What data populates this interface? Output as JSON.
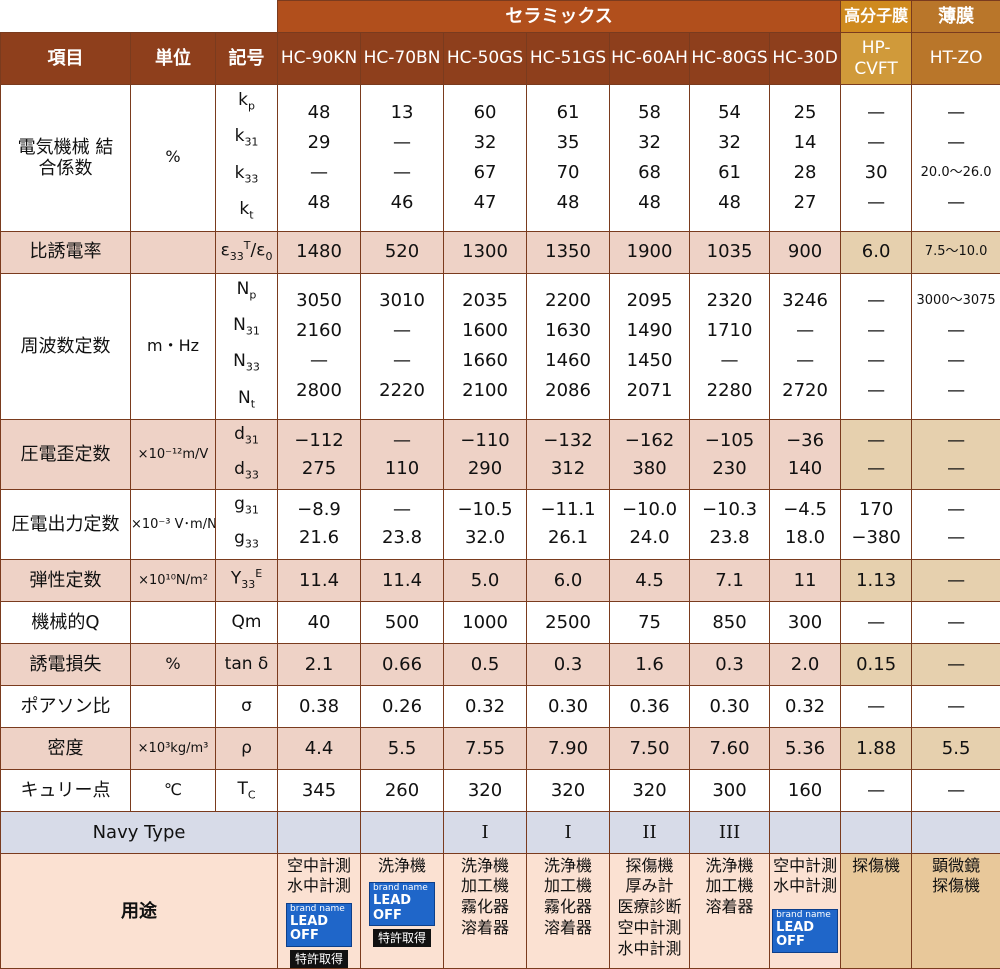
{
  "groups": {
    "ceramics": "セラミックス",
    "polymer": "高分子膜",
    "thin": "薄膜"
  },
  "header": {
    "item": "項目",
    "unit": "単位",
    "symbol": "記号",
    "models": [
      "HC-90KN",
      "HC-70BN",
      "HC-50GS",
      "HC-51GS",
      "HC-60AH",
      "HC-80GS",
      "HC-30D",
      "HP-CVFT",
      "HT-ZO"
    ]
  },
  "rows": [
    {
      "item": "電気機械 結合係数",
      "unit": "%",
      "cls": "",
      "symbols": [
        {
          "m": "k",
          "s": "p",
          "t": "sub"
        },
        {
          "m": "k",
          "s": "31",
          "t": "sub"
        },
        {
          "m": "k",
          "s": "33",
          "t": "sub"
        },
        {
          "m": "k",
          "s": "t",
          "t": "sub"
        }
      ],
      "values": [
        [
          "48",
          "29",
          "—",
          "48"
        ],
        [
          "13",
          "—",
          "—",
          "46"
        ],
        [
          "60",
          "32",
          "67",
          "47"
        ],
        [
          "61",
          "35",
          "70",
          "48"
        ],
        [
          "58",
          "32",
          "68",
          "48"
        ],
        [
          "54",
          "32",
          "61",
          "48"
        ],
        [
          "25",
          "14",
          "28",
          "27"
        ],
        [
          "—",
          "—",
          "30",
          "—"
        ],
        [
          "—",
          "—",
          "20.0～26.0",
          "—"
        ]
      ]
    },
    {
      "item": "比誘電率",
      "unit": "",
      "cls": "pink",
      "symbols": [
        {
          "m": "ε",
          "s": "33",
          "t": "sub",
          "sup": "T",
          "after": "/ε",
          "s2": "0"
        }
      ],
      "values": [
        [
          "1480"
        ],
        [
          "520"
        ],
        [
          "1300"
        ],
        [
          "1350"
        ],
        [
          "1900"
        ],
        [
          "1035"
        ],
        [
          "900"
        ],
        [
          "6.0"
        ],
        [
          "7.5～10.0"
        ]
      ]
    },
    {
      "item": "周波数定数",
      "unit": "m・Hz",
      "cls": "",
      "symbols": [
        {
          "m": "N",
          "s": "p",
          "t": "sub"
        },
        {
          "m": "N",
          "s": "31",
          "t": "sub"
        },
        {
          "m": "N",
          "s": "33",
          "t": "sub"
        },
        {
          "m": "N",
          "s": "t",
          "t": "sub"
        }
      ],
      "values": [
        [
          "3050",
          "2160",
          "—",
          "2800"
        ],
        [
          "3010",
          "—",
          "—",
          "2220"
        ],
        [
          "2035",
          "1600",
          "1660",
          "2100"
        ],
        [
          "2200",
          "1630",
          "1460",
          "2086"
        ],
        [
          "2095",
          "1490",
          "1450",
          "2071"
        ],
        [
          "2320",
          "1710",
          "—",
          "2280"
        ],
        [
          "3246",
          "—",
          "—",
          "2720"
        ],
        [
          "—",
          "—",
          "—",
          "—"
        ],
        [
          "3000～3075",
          "—",
          "—",
          "—"
        ]
      ]
    },
    {
      "item": "圧電歪定数",
      "unit": "×10⁻¹²m/V",
      "cls": "pink",
      "symbols": [
        {
          "m": "d",
          "s": "31",
          "t": "sub"
        },
        {
          "m": "d",
          "s": "33",
          "t": "sub"
        }
      ],
      "values": [
        [
          "−112",
          "275"
        ],
        [
          "—",
          "110"
        ],
        [
          "−110",
          "290"
        ],
        [
          "−132",
          "312"
        ],
        [
          "−162",
          "380"
        ],
        [
          "−105",
          "230"
        ],
        [
          "−36",
          "140"
        ],
        [
          "—",
          "—"
        ],
        [
          "—",
          "—"
        ]
      ]
    },
    {
      "item": "圧電出力定数",
      "unit": "×10⁻³ V･m/N",
      "cls": "",
      "symbols": [
        {
          "m": "g",
          "s": "31",
          "t": "sub"
        },
        {
          "m": "g",
          "s": "33",
          "t": "sub"
        }
      ],
      "values": [
        [
          "−8.9",
          "21.6"
        ],
        [
          "—",
          "23.8"
        ],
        [
          "−10.5",
          "32.0"
        ],
        [
          "−11.1",
          "26.1"
        ],
        [
          "−10.0",
          "24.0"
        ],
        [
          "−10.3",
          "23.8"
        ],
        [
          "−4.5",
          "18.0"
        ],
        [
          "170",
          "−380"
        ],
        [
          "—",
          "—"
        ]
      ]
    },
    {
      "item": "弾性定数",
      "unit": "×10¹⁰N/m²",
      "cls": "pink",
      "symbols": [
        {
          "m": "Y",
          "s": "33",
          "t": "sub",
          "sup": "E"
        }
      ],
      "values": [
        [
          "11.4"
        ],
        [
          "11.4"
        ],
        [
          "5.0"
        ],
        [
          "6.0"
        ],
        [
          "4.5"
        ],
        [
          "7.1"
        ],
        [
          "11"
        ],
        [
          "1.13"
        ],
        [
          "—"
        ]
      ]
    },
    {
      "item": "機械的Q",
      "unit": "",
      "cls": "",
      "symbols": [
        {
          "m": "Qm"
        }
      ],
      "values": [
        [
          "40"
        ],
        [
          "500"
        ],
        [
          "1000"
        ],
        [
          "2500"
        ],
        [
          "75"
        ],
        [
          "850"
        ],
        [
          "300"
        ],
        [
          "—"
        ],
        [
          "—"
        ]
      ]
    },
    {
      "item": "誘電損失",
      "unit": "%",
      "cls": "pink",
      "symbols": [
        {
          "m": "tan δ"
        }
      ],
      "values": [
        [
          "2.1"
        ],
        [
          "0.66"
        ],
        [
          "0.5"
        ],
        [
          "0.3"
        ],
        [
          "1.6"
        ],
        [
          "0.3"
        ],
        [
          "2.0"
        ],
        [
          "0.15"
        ],
        [
          "—"
        ]
      ]
    },
    {
      "item": "ポアソン比",
      "unit": "",
      "cls": "",
      "symbols": [
        {
          "m": "σ"
        }
      ],
      "values": [
        [
          "0.38"
        ],
        [
          "0.26"
        ],
        [
          "0.32"
        ],
        [
          "0.30"
        ],
        [
          "0.36"
        ],
        [
          "0.30"
        ],
        [
          "0.32"
        ],
        [
          "—"
        ],
        [
          "—"
        ]
      ]
    },
    {
      "item": "密度",
      "unit": "×10³kg/m³",
      "cls": "pink",
      "symbols": [
        {
          "m": "ρ"
        }
      ],
      "values": [
        [
          "4.4"
        ],
        [
          "5.5"
        ],
        [
          "7.55"
        ],
        [
          "7.90"
        ],
        [
          "7.50"
        ],
        [
          "7.60"
        ],
        [
          "5.36"
        ],
        [
          "1.88"
        ],
        [
          "5.5"
        ]
      ]
    },
    {
      "item": "キュリー点",
      "unit": "℃",
      "cls": "",
      "symbols": [
        {
          "m": "T",
          "s": "C",
          "t": "sub"
        }
      ],
      "values": [
        [
          "345"
        ],
        [
          "260"
        ],
        [
          "320"
        ],
        [
          "320"
        ],
        [
          "320"
        ],
        [
          "300"
        ],
        [
          "160"
        ],
        [
          "—"
        ],
        [
          "—"
        ]
      ]
    }
  ],
  "navy": {
    "label": "Navy Type",
    "values": [
      "",
      "",
      "I",
      "I",
      "II",
      "III",
      "",
      "",
      ""
    ]
  },
  "usage": {
    "label": "用途",
    "values": [
      [
        "空中計測",
        "水中計測"
      ],
      [
        "洗浄機"
      ],
      [
        "洗浄機",
        "加工機",
        "霧化器",
        "溶着器"
      ],
      [
        "洗浄機",
        "加工機",
        "霧化器",
        "溶着器"
      ],
      [
        "探傷機",
        "厚み計",
        "医療診断",
        "空中計測",
        "水中計測"
      ],
      [
        "洗浄機",
        "加工機",
        "溶着器"
      ],
      [
        "空中計測",
        "水中計測"
      ],
      [
        "探傷機"
      ],
      [
        "顕微鏡",
        "探傷機"
      ]
    ],
    "badge": {
      "line1": "brand name",
      "line2": "LEAD OFF"
    },
    "patent": "特許取得",
    "badge_cols": [
      0,
      1,
      6
    ],
    "patent_cols": [
      0,
      1
    ]
  },
  "colors": {
    "header": "#8e3f1c",
    "ceramics": "#b14f1c",
    "polymer": "#cf8a1f",
    "thin": "#b9762a",
    "band": "#eed2c6",
    "badge": "#1f66c9"
  }
}
